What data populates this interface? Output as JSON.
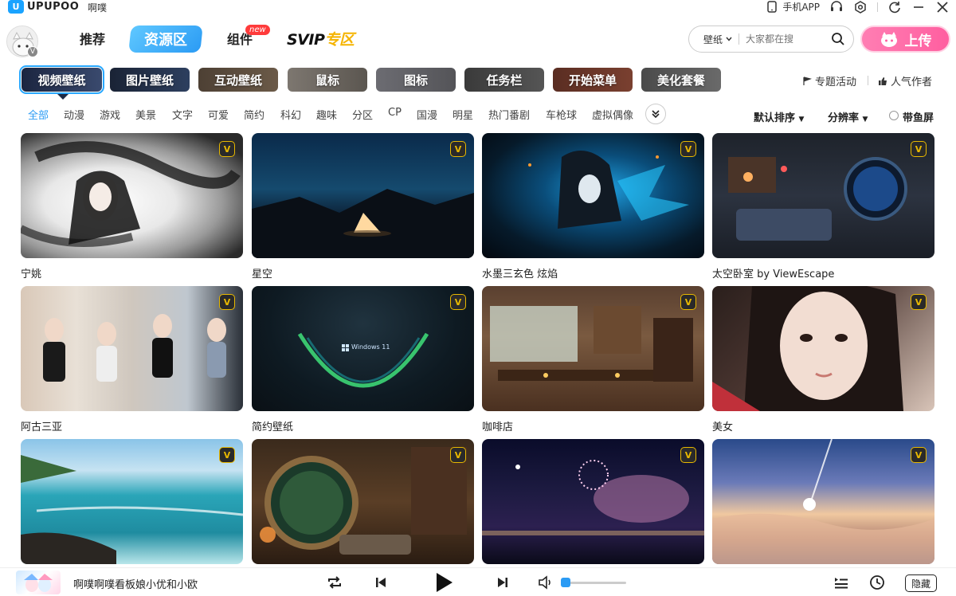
{
  "titlebar": {
    "brand": "UPUPOO",
    "subtitle": "啊噗",
    "mobile_app": "手机APP"
  },
  "nav": {
    "recommend": "推荐",
    "resources": "资源区",
    "widgets": "组件",
    "new_badge": "new",
    "svip_prefix": "SVIP",
    "svip_suffix": "专区"
  },
  "search": {
    "scope": "壁纸",
    "placeholder": "大家都在搜"
  },
  "upload_label": "上传",
  "categories": [
    {
      "label": "视频壁纸",
      "active": true
    },
    {
      "label": "图片壁纸"
    },
    {
      "label": "互动壁纸"
    },
    {
      "label": "鼠标"
    },
    {
      "label": "图标"
    },
    {
      "label": "任务栏"
    },
    {
      "label": "开始菜单"
    },
    {
      "label": "美化套餐"
    }
  ],
  "right_links": {
    "topics": "专题活动",
    "popular_authors": "人气作者"
  },
  "filters": [
    "全部",
    "动漫",
    "游戏",
    "美景",
    "文字",
    "可爱",
    "简约",
    "科幻",
    "趣味",
    "分区",
    "CP",
    "国漫",
    "明星",
    "热门番剧",
    "车枪球",
    "虚拟偶像"
  ],
  "sort": {
    "default": "默认排序",
    "resolution": "分辨率",
    "fish_screen": "带鱼屏"
  },
  "wallpapers": [
    {
      "title": "宁姚"
    },
    {
      "title": "星空"
    },
    {
      "title": "水墨三玄色 炫焰"
    },
    {
      "title": "太空卧室 by ViewEscape"
    },
    {
      "title": "阿古三亚"
    },
    {
      "title": "简约壁纸"
    },
    {
      "title": "咖啡店"
    },
    {
      "title": "美女"
    },
    {
      "title": ""
    },
    {
      "title": ""
    },
    {
      "title": ""
    },
    {
      "title": ""
    }
  ],
  "badge_letter": "V",
  "thumb_text": {
    "windows": "Windows 11"
  },
  "player": {
    "title": "啊噗啊噗看板娘小优和小欧",
    "hide": "隐藏"
  },
  "colors": {
    "accent": "#2b9bf4",
    "upload": "#ff6aa8",
    "vip_gold": "#e8b800"
  }
}
